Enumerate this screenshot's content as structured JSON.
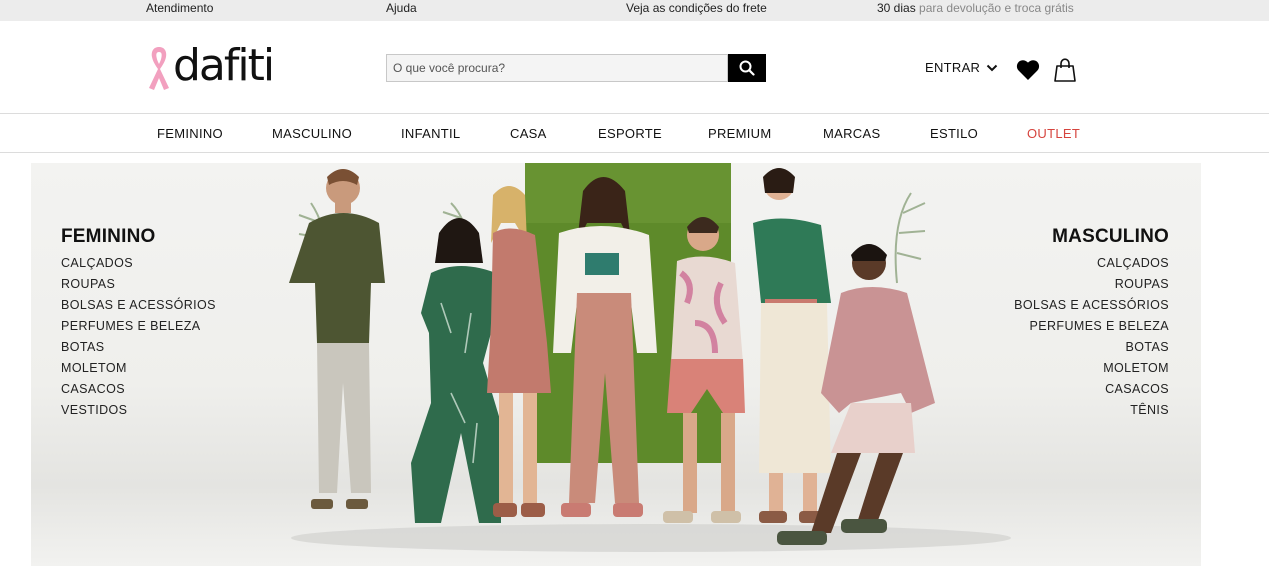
{
  "topbar": {
    "service": "Atendimento",
    "help": "Ajuda",
    "shipping": "Veja as condições do frete",
    "returns_days": "30 dias",
    "returns_rest": "para devolução e troca grátis"
  },
  "header": {
    "logo_text": "dafiti",
    "search_placeholder": "O que você procura?",
    "login_label": "ENTRAR"
  },
  "nav": {
    "items": [
      "FEMININO",
      "MASCULINO",
      "INFANTIL",
      "CASA",
      "ESPORTE",
      "PREMIUM",
      "MARCAS",
      "ESTILO",
      "OUTLET"
    ]
  },
  "hero": {
    "female": {
      "title": "FEMININO",
      "links": [
        "CALÇADOS",
        "ROUPAS",
        "BOLSAS E ACESSÓRIOS",
        "PERFUMES E BELEZA",
        "BOTAS",
        "MOLETOM",
        "CASACOS",
        "VESTIDOS"
      ]
    },
    "male": {
      "title": "MASCULINO",
      "links": [
        "CALÇADOS",
        "ROUPAS",
        "BOLSAS E ACESSÓRIOS",
        "PERFUMES E BELEZA",
        "BOTAS",
        "MOLETOM",
        "CASACOS",
        "TÊNIS"
      ]
    }
  },
  "colors": {
    "outlet": "#d6443e",
    "ribbon": "#f2a0bf",
    "backdrop_green": "#5e8a2a"
  }
}
